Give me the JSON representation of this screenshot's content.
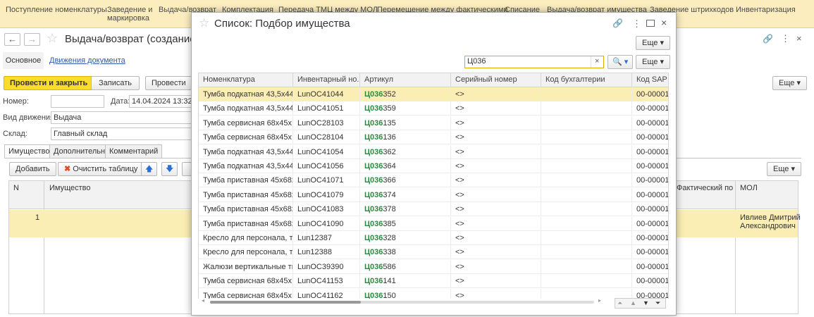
{
  "topnav": [
    "Поступление номенклатуры",
    "Заведение и маркировка",
    "Выдача/возврат",
    "Комплектация",
    "Передача ТМЦ между МОЛ",
    "Перемещение между фактическими",
    "Списание",
    "Выдача/возврат имущества",
    "Заведение штрихкодов",
    "Инвентаризация"
  ],
  "topnav_wrap": {
    "line1": "Заведение и",
    "line2": "маркировка"
  },
  "form": {
    "title": "Выдача/возврат (создание)",
    "tabs_top": {
      "main": "Основное",
      "movements": "Движения документа"
    },
    "toolbar": {
      "post_close": "Провести и закрыть",
      "save": "Записать",
      "post": "Провести",
      "more": "Еще"
    },
    "fields": {
      "number_label": "Номер:",
      "number_value": "",
      "date_label": "Дата:",
      "date_value": "14.04.2024 13:32:2",
      "movement_label": "Вид движения:",
      "movement_value": "Выдача",
      "warehouse_label": "Склад:",
      "warehouse_value": "Главный склад"
    },
    "subtabs": [
      "Имущество",
      "Дополнительно",
      "Комментарий"
    ],
    "table_toolbar": {
      "add": "Добавить",
      "clear": "Очистить таблицу",
      "more": "Еще"
    },
    "table_headers": {
      "n": "N",
      "property": "Имущество",
      "actual": "Фактический по...",
      "mol": "МОЛ"
    },
    "table_row": {
      "n": "1",
      "mol_line1": "Ивлиев Дмитрий",
      "mol_line2": "Александрович"
    }
  },
  "dialog": {
    "title": "Список: Подбор имущества",
    "more": "Еще",
    "search_value": "Ц036",
    "columns": [
      "Номенклатура",
      "Инвентарный но...",
      "Артикул",
      "Серийный номер",
      "Код бухгалтерии",
      "Код SAP"
    ],
    "highlight": "Ц036",
    "rows": [
      {
        "name": "Тумба подкатная 43,5х44...",
        "inv": "LunOC41044",
        "art_rest": "352",
        "serial": "<>",
        "sap": "00-00001"
      },
      {
        "name": "Тумба подкатная 43,5х44...",
        "inv": "LunOC41051",
        "art_rest": "359",
        "serial": "<>",
        "sap": "00-00001"
      },
      {
        "name": "Тумба сервисная 68х45х...",
        "inv": "LunOC28103",
        "art_rest": "135",
        "serial": "<>",
        "sap": "00-00001"
      },
      {
        "name": "Тумба сервисная 68х45х...",
        "inv": "LunOC28104",
        "art_rest": "136",
        "serial": "<>",
        "sap": "00-00001"
      },
      {
        "name": "Тумба подкатная 43,5х44...",
        "inv": "LunOC41054",
        "art_rest": "362",
        "serial": "<>",
        "sap": "00-00001"
      },
      {
        "name": "Тумба подкатная 43,5х44...",
        "inv": "LunOC41056",
        "art_rest": "364",
        "serial": "<>",
        "sap": "00-00001"
      },
      {
        "name": "Тумба приставная 45х68х...",
        "inv": "LunOC41071",
        "art_rest": "366",
        "serial": "<>",
        "sap": "00-00001"
      },
      {
        "name": "Тумба приставная 45х68х...",
        "inv": "LunOC41079",
        "art_rest": "374",
        "serial": "<>",
        "sap": "00-00001"
      },
      {
        "name": "Тумба приставная 45х68х...",
        "inv": "LunOC41083",
        "art_rest": "378",
        "serial": "<>",
        "sap": "00-00001"
      },
      {
        "name": "Тумба приставная 45х68х...",
        "inv": "LunOC41090",
        "art_rest": "385",
        "serial": "<>",
        "sap": "00-00001"
      },
      {
        "name": "Кресло для персонала, тк...",
        "inv": "Lun12387",
        "art_rest": "328",
        "serial": "<>",
        "sap": "00-00001"
      },
      {
        "name": "Кресло для персонала, тк...",
        "inv": "Lun12388",
        "art_rest": "338",
        "serial": "<>",
        "sap": "00-00001"
      },
      {
        "name": "Жалюзи вертикальные тк...",
        "inv": "LunOC39390",
        "art_rest": "586",
        "serial": "<>",
        "sap": "00-00001"
      },
      {
        "name": "Тумба сервисная 68х45х...",
        "inv": "LunOC41153",
        "art_rest": "141",
        "serial": "<>",
        "sap": "00-00001"
      },
      {
        "name": "Тумба сервисная 68х45х...",
        "inv": "LunOC41162",
        "art_rest": "150",
        "serial": "<>",
        "sap": "00-00001"
      }
    ],
    "selected_row": 0
  },
  "colors": {
    "topbar": "#fbedbe",
    "accent_yellow": "#f9dc2c",
    "selected_row": "#fbeeb4",
    "highlight_green": "#2b8a3e",
    "link_blue": "#2f5aa8"
  }
}
